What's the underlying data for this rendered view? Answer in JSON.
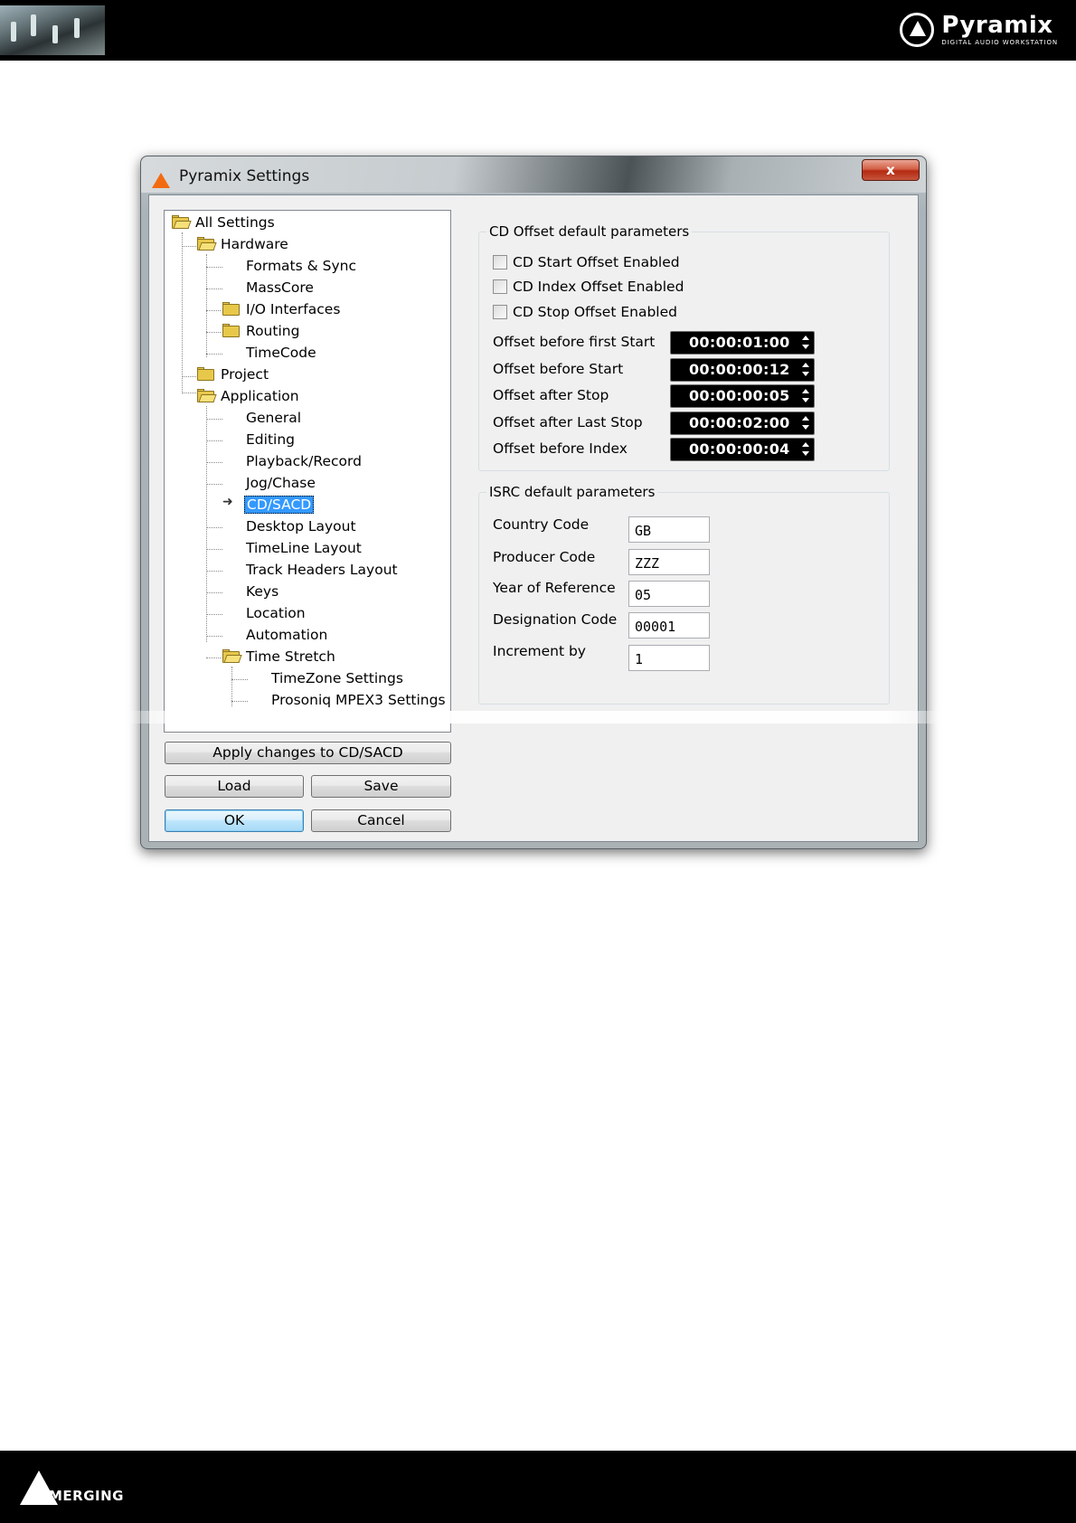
{
  "page": {
    "brand_name": "Pyramix",
    "brand_tagline": "DIGITAL AUDIO WORKSTATION",
    "footer_brand": "MERGING"
  },
  "window": {
    "title": "Pyramix Settings",
    "close_label": "x"
  },
  "tree": {
    "items": [
      {
        "label": "All Settings"
      },
      {
        "label": "Hardware"
      },
      {
        "label": "Formats & Sync"
      },
      {
        "label": "MassCore"
      },
      {
        "label": "I/O Interfaces"
      },
      {
        "label": "Routing"
      },
      {
        "label": "TimeCode"
      },
      {
        "label": "Project"
      },
      {
        "label": "Application"
      },
      {
        "label": "General"
      },
      {
        "label": "Editing"
      },
      {
        "label": "Playback/Record"
      },
      {
        "label": "Jog/Chase"
      },
      {
        "label": "CD/SACD"
      },
      {
        "label": "Desktop Layout"
      },
      {
        "label": "TimeLine Layout"
      },
      {
        "label": "Track Headers Layout"
      },
      {
        "label": "Keys"
      },
      {
        "label": "Location"
      },
      {
        "label": "Automation"
      },
      {
        "label": "Time Stretch"
      },
      {
        "label": "TimeZone Settings"
      },
      {
        "label": "Prosoniq MPEX3 Settings"
      }
    ],
    "selected": "CD/SACD"
  },
  "buttons": {
    "apply": "Apply changes to CD/SACD",
    "load": "Load",
    "save": "Save",
    "ok": "OK",
    "cancel": "Cancel"
  },
  "cd_offset": {
    "title": "CD Offset default parameters",
    "checkboxes": [
      {
        "label": "CD Start Offset Enabled",
        "checked": false
      },
      {
        "label": "CD Index Offset Enabled",
        "checked": false
      },
      {
        "label": "CD Stop Offset Enabled",
        "checked": false
      }
    ],
    "offsets": [
      {
        "label": "Offset before first Start",
        "value": "00:00:01:00"
      },
      {
        "label": "Offset before Start",
        "value": "00:00:00:12"
      },
      {
        "label": "Offset after Stop",
        "value": "00:00:00:05"
      },
      {
        "label": "Offset after Last Stop",
        "value": "00:00:02:00"
      },
      {
        "label": "Offset before Index",
        "value": "00:00:00:04"
      }
    ]
  },
  "isrc": {
    "title": "ISRC default parameters",
    "fields": [
      {
        "label": "Country Code",
        "value": "GB"
      },
      {
        "label": "Producer Code",
        "value": "ZZZ"
      },
      {
        "label": "Year of Reference",
        "value": "05"
      },
      {
        "label": "Designation Code",
        "value": "00001"
      },
      {
        "label": "Increment by",
        "value": "1"
      }
    ]
  }
}
